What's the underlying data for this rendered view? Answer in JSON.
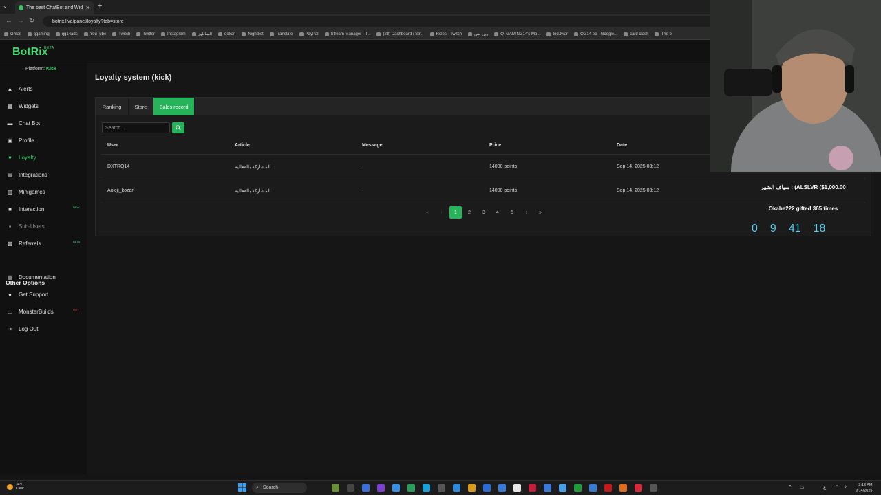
{
  "browser": {
    "tab_title": "The best ChatBot and Widgets",
    "url": "botrix.live/panel/loyalty?tab=store",
    "bookmarks": [
      "Gmail",
      "qgaming",
      "qg14ads",
      "YouTube",
      "Twitch",
      "Twitter",
      "Instagram",
      "السايلوز",
      "dokan",
      "Nightbot",
      "Translate",
      "PayPal",
      "Stream Manager - T...",
      "(28) Dashboard / Str...",
      "Roles - Twitch",
      "وين بس",
      "Q_GAMING14's Mo...",
      "tod.tv/ar",
      "QG14 ep - Google...",
      "card clash",
      "The b"
    ]
  },
  "brand": {
    "name": "BotRix",
    "tag": "BETA",
    "accent": "#3ddc71"
  },
  "sidebar": {
    "platform_label": "Platform:",
    "platform_value": "Kick",
    "items": [
      {
        "label": "Alerts",
        "icon": "warning-icon"
      },
      {
        "label": "Widgets",
        "icon": "grid-icon"
      },
      {
        "label": "Chat Bot",
        "icon": "chat-icon"
      },
      {
        "label": "Profile",
        "icon": "profile-icon"
      },
      {
        "label": "Loyalty",
        "icon": "heart-icon"
      },
      {
        "label": "Integrations",
        "icon": "integrations-icon"
      },
      {
        "label": "Minigames",
        "icon": "gamepad-icon"
      },
      {
        "label": "Interaction",
        "icon": "interaction-icon",
        "badge": "NEW"
      },
      {
        "label": "Sub-Users",
        "icon": "users-icon"
      },
      {
        "label": "Referrals",
        "icon": "referrals-icon",
        "badge": "BETA"
      }
    ],
    "other_title": "Other Options",
    "other_items": [
      {
        "label": "Documentation",
        "icon": "document-icon"
      },
      {
        "label": "Get Support",
        "icon": "support-icon"
      },
      {
        "label": "MonsterBuilds",
        "icon": "monitor-icon",
        "badge": "HOT"
      },
      {
        "label": "Log Out",
        "icon": "logout-icon"
      }
    ]
  },
  "main": {
    "title": "Loyalty system (kick)",
    "tabs": [
      "Ranking",
      "Store",
      "Sales record"
    ],
    "search_placeholder": "Search...",
    "columns": [
      "User",
      "Article",
      "Message",
      "Price",
      "Date"
    ],
    "rows": [
      {
        "user": "DXTRQ14",
        "article": "المشاركة بالفعالية",
        "message": "-",
        "price": "14000 points",
        "date": "Sep 14, 2025 03:12"
      },
      {
        "user": "Aokiji_kozan",
        "article": "المشاركة بالفعالية",
        "message": "-",
        "price": "14000 points",
        "date": "Sep 14, 2025 03:12"
      }
    ],
    "pagination": {
      "first": "«",
      "prev": "‹",
      "pages": [
        "1",
        "2",
        "3",
        "4",
        "5"
      ],
      "next": "›",
      "last": "»",
      "current": 1
    }
  },
  "stream_overlay": {
    "line1": "سياف الشهر : (ALSLVR ($1,000.00",
    "line2": "Okabe222 gifted 365 times",
    "timer": [
      "0",
      "9",
      "41",
      "18"
    ]
  },
  "taskbar": {
    "weather_temp": "34°C",
    "weather_text": "Clear",
    "search_label": "Search",
    "time": "3:13 AM",
    "date": "9/14/2025"
  }
}
